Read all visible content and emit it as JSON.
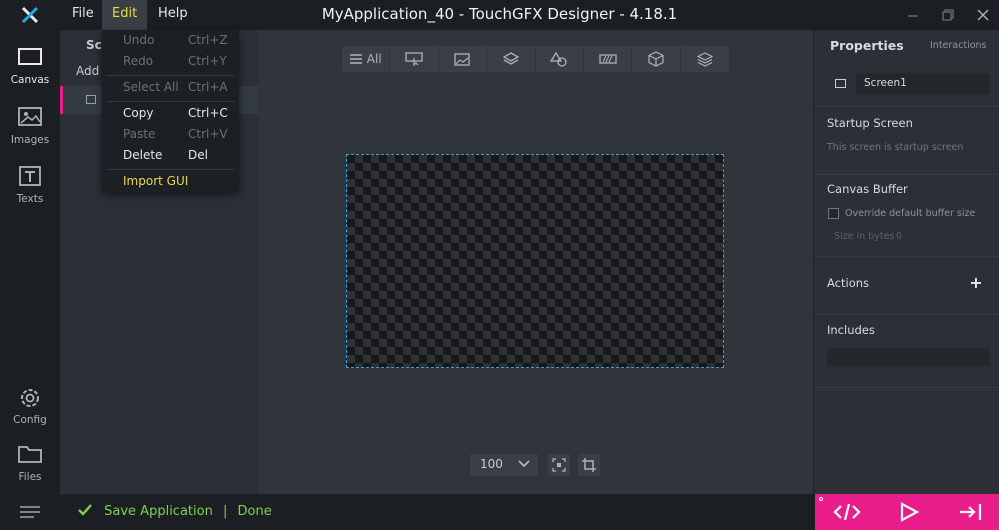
{
  "titlebar": {
    "title": "MyApplication_40 - TouchGFX Designer - 4.18.1",
    "menus": {
      "file": "File",
      "edit": "Edit",
      "help": "Help"
    }
  },
  "nav": {
    "canvas": "Canvas",
    "images": "Images",
    "texts": "Texts",
    "config": "Config",
    "files": "Files"
  },
  "screens_panel": {
    "title": "Scr",
    "add_screen": "Add S"
  },
  "edit_menu": {
    "items": [
      {
        "label": "Undo",
        "shortcut": "Ctrl+Z",
        "enabled": false
      },
      {
        "label": "Redo",
        "shortcut": "Ctrl+Y",
        "enabled": false
      },
      {
        "label": "Select All",
        "shortcut": "Ctrl+A",
        "enabled": false
      },
      {
        "label": "Copy",
        "shortcut": "Ctrl+C",
        "enabled": true
      },
      {
        "label": "Paste",
        "shortcut": "Ctrl+V",
        "enabled": false
      },
      {
        "label": "Delete",
        "shortcut": "Del",
        "enabled": true
      },
      {
        "label": "Import GUI",
        "shortcut": "",
        "enabled": true
      }
    ]
  },
  "toolbar": {
    "all_label": "All",
    "icons": [
      "list-icon",
      "button-icon",
      "image-icon",
      "layers-icon",
      "shapes-icon",
      "progress-icon",
      "cube-icon",
      "stack-icon"
    ]
  },
  "zoom": {
    "value": "100"
  },
  "properties": {
    "title": "Properties",
    "tab_interactions": "Interactions",
    "screen_name": "Screen1",
    "startup_heading": "Startup Screen",
    "startup_text": "This screen is startup screen",
    "canvas_buffer_heading": "Canvas Buffer",
    "override_label": "Override default buffer size",
    "size_label": "Size in bytes",
    "size_value": "0",
    "actions_heading": "Actions",
    "actions_add": "+",
    "includes_heading": "Includes"
  },
  "status": {
    "text": "Save Application",
    "separator": "|",
    "result": "Done"
  },
  "colors": {
    "accent": "#e91e8c",
    "highlight": "#e8d94a",
    "success": "#7fd346",
    "canvas_border": "#29a8e0"
  }
}
